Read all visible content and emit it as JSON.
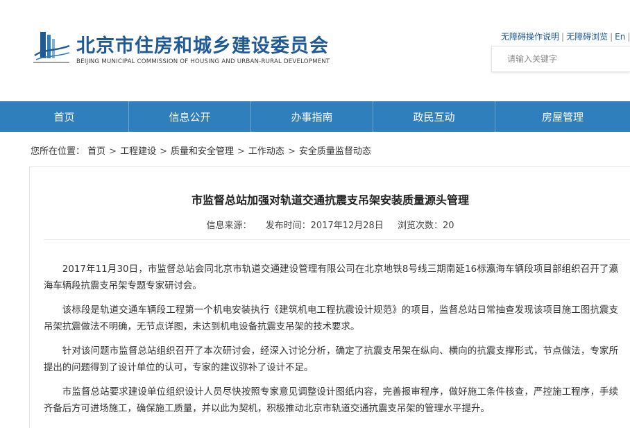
{
  "header": {
    "title": "北京市住房和城乡建设委员会",
    "subtitle": "BEIJING MUNICIPAL COMMISSION OF HOUSING AND URBAN-RURAL DEVELOPMENT",
    "links": [
      "无障碍操作说明",
      "无障碍浏览",
      "En"
    ],
    "search_placeholder": "请输入关键字"
  },
  "nav": {
    "items": [
      "首页",
      "信息公开",
      "办事指南",
      "政民互动",
      "房屋管理"
    ]
  },
  "breadcrumb": {
    "prefix": "您所在位置：",
    "items": [
      "首页",
      "工程建设",
      "质量和安全管理",
      "工作动态",
      "安全质量监督动态"
    ]
  },
  "article": {
    "title": "市监督总站加强对轨道交通抗震支吊架安装质量源头管理",
    "source_label": "信息来源：",
    "date_label": "发布时间：2017年12月28日",
    "views_label": "浏览次数：20",
    "paragraphs": [
      "2017年11月30日，市监督总站会同北京市轨道交通建设管理有限公司在北京地铁8号线三期南延16标瀛海车辆段项目部组织召开了瀛海车辆段抗震支吊架专题专家研讨会。",
      "该标段是轨道交通车辆段工程第一个机电安装执行《建筑机电工程抗震设计规范》的项目，监督总站日常抽查发现该项目施工图抗震支吊架抗震做法不明确，无节点详图，未达到机电设备抗震支吊架的技术要求。",
      "针对该问题市监督总站组织召开了本次研讨会，经深入讨论分析，确定了抗震支吊架在纵向、横向的抗震支撑形式，节点做法，专家所提出的问题得到了设计单位的认可，专家的建议弥补了设计不足。",
      "市监督总站要求建设单位组织设计人员尽快按照专家意见调整设计图纸内容，完善报审程序，做好施工条件核查，严控施工程序，手续齐备后方可进场施工，确保施工质量，并以此为契机，积极推动北京市轨道交通抗震支吊架的管理水平提升。"
    ]
  },
  "colors": {
    "brand_blue": "#1f5a96",
    "nav_blue": "#2f7fbd"
  }
}
